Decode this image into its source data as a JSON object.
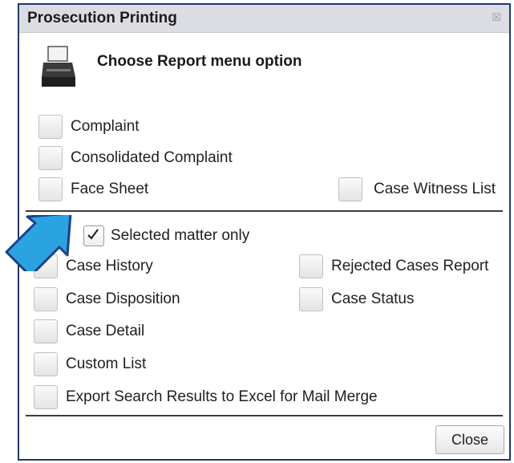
{
  "window": {
    "title": "Prosecution Printing",
    "close_glyph": "☒"
  },
  "heading": "Choose Report menu option",
  "section1": {
    "complaint": "Complaint",
    "consolidated_complaint": "Consolidated Complaint",
    "face_sheet": "Face Sheet",
    "case_witness_list": "Case Witness List"
  },
  "selected_only": {
    "label": "Selected matter only",
    "checked": true
  },
  "section2": {
    "case_history": "Case History",
    "rejected_cases_report": "Rejected Cases Report",
    "case_disposition": "Case Disposition",
    "case_status": "Case Status",
    "case_detail": "Case Detail",
    "custom_list": "Custom List",
    "export_search_results": "Export Search Results to Excel for Mail Merge"
  },
  "footer": {
    "close_label": "Close"
  },
  "colors": {
    "title_bar": "#dcdde3",
    "frame": "#203a6f",
    "arrow_fill": "#2aa3e0",
    "arrow_outline": "#1c3f8a"
  }
}
